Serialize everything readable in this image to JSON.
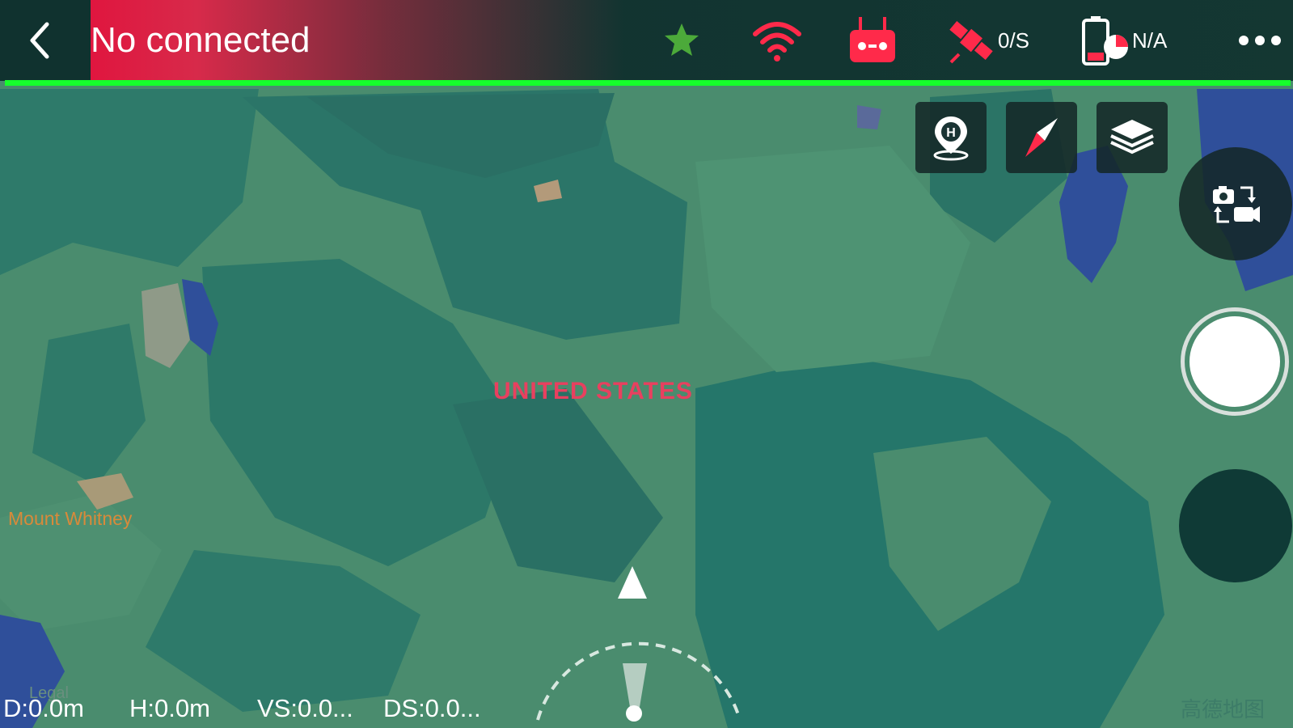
{
  "colors": {
    "map_base": "#4a8c6e",
    "map_dark": "#2a7a6a",
    "water": "#2f4f9a",
    "accent_red": "#e0163f",
    "progress_green": "#16ff2c",
    "label_red": "#e8405f",
    "label_orange": "#d98a3a"
  },
  "header": {
    "back_icon": "chevron-left-icon",
    "status_text": "No connected",
    "indicators": [
      {
        "icon": "drone-star-icon"
      },
      {
        "icon": "wifi-icon"
      },
      {
        "icon": "remote-controller-icon"
      },
      {
        "icon": "satellite-icon",
        "value": "0/S"
      },
      {
        "icon": "battery-icon",
        "value": "N/A"
      },
      {
        "icon": "more-icon"
      }
    ]
  },
  "map_controls": {
    "home_point_icon": "home-point-icon",
    "compass_icon": "compass-icon",
    "layers_icon": "layers-icon"
  },
  "camera_controls": {
    "switch_icon": "camera-switch-icon",
    "shutter": "shutter-button",
    "secondary": "secondary-button"
  },
  "map_labels": {
    "country": "UNITED STATES",
    "place": "Mount Whitney",
    "legal": "Legal",
    "watermark": "高德地图"
  },
  "telemetry": {
    "distance": "D:0.0m",
    "height": "H:0.0m",
    "vertical_speed": "VS:0.0...",
    "horizontal_speed": "DS:0.0..."
  }
}
